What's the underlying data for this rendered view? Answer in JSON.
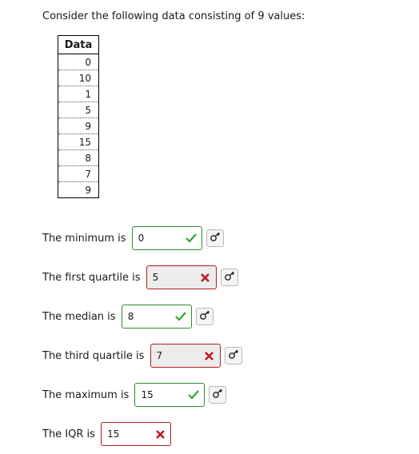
{
  "intro": "Consider the following data consisting of 9 values:",
  "table": {
    "header": "Data",
    "values": [
      "0",
      "10",
      "1",
      "5",
      "9",
      "15",
      "8",
      "7",
      "9"
    ]
  },
  "questions": [
    {
      "label": "The minimum is ",
      "answer": "0",
      "status": "correct"
    },
    {
      "label": "The first quartile is ",
      "answer": "5",
      "status": "incorrect"
    },
    {
      "label": "The median is ",
      "answer": "8",
      "status": "correct"
    },
    {
      "label": "The third quartile is ",
      "answer": "7",
      "status": "incorrect"
    },
    {
      "label": "The maximum is ",
      "answer": "15",
      "status": "correct"
    },
    {
      "label": "The IQR is ",
      "answer": "15",
      "status": "incorrect"
    }
  ],
  "icons": {
    "correct": "check-icon",
    "incorrect": "x-icon",
    "key": "key-icon"
  },
  "colors": {
    "correct": "#2e8b2e",
    "incorrect": "#b21e1e",
    "check": "#2ea82e",
    "cross": "#c0141e"
  }
}
